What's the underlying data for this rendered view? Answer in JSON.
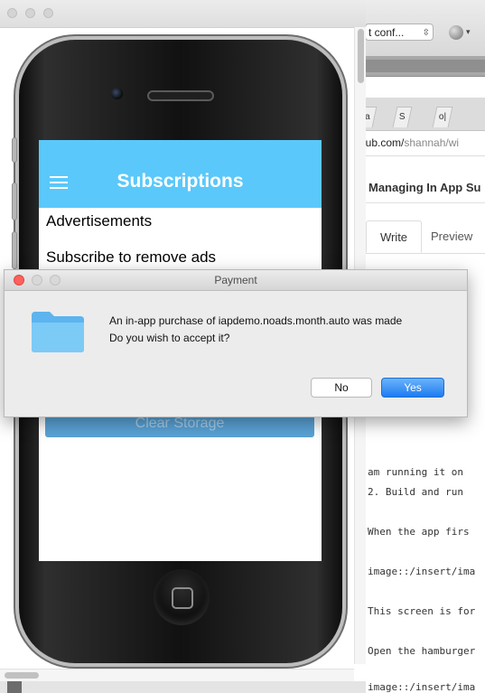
{
  "browser": {
    "select_text": "t conf...",
    "tabs": [
      "ja",
      "S",
      "o|"
    ],
    "url_host": "hub.com/",
    "url_path": "shannah/wi",
    "page_title": "Managing In App Su",
    "editor_tabs": {
      "write": "Write",
      "preview": "Preview"
    },
    "markdown_lines": [
      "am running it on",
      "2. Build and run",
      "When the app firs",
      "image::/insert/ima",
      "This screen is for",
      "Open the hamburger",
      "image::/insert/ima"
    ]
  },
  "app": {
    "title": "Subscriptions",
    "menu_icon": "hamburger-menu-icon",
    "label_advertisements": "Advertisements",
    "label_subscribe": "Subscribe to remove ads",
    "clear_storage_button": "Clear Storage",
    "bar_color": "#5ac8fa"
  },
  "dialog": {
    "title": "Payment",
    "icon": "folder-icon",
    "message_line1": "An in-app purchase of iapdemo.noads.month.auto was made",
    "message_line2": "Do you wish to accept it?",
    "no_label": "No",
    "yes_label": "Yes",
    "accent_color": "#1d7cf2"
  }
}
